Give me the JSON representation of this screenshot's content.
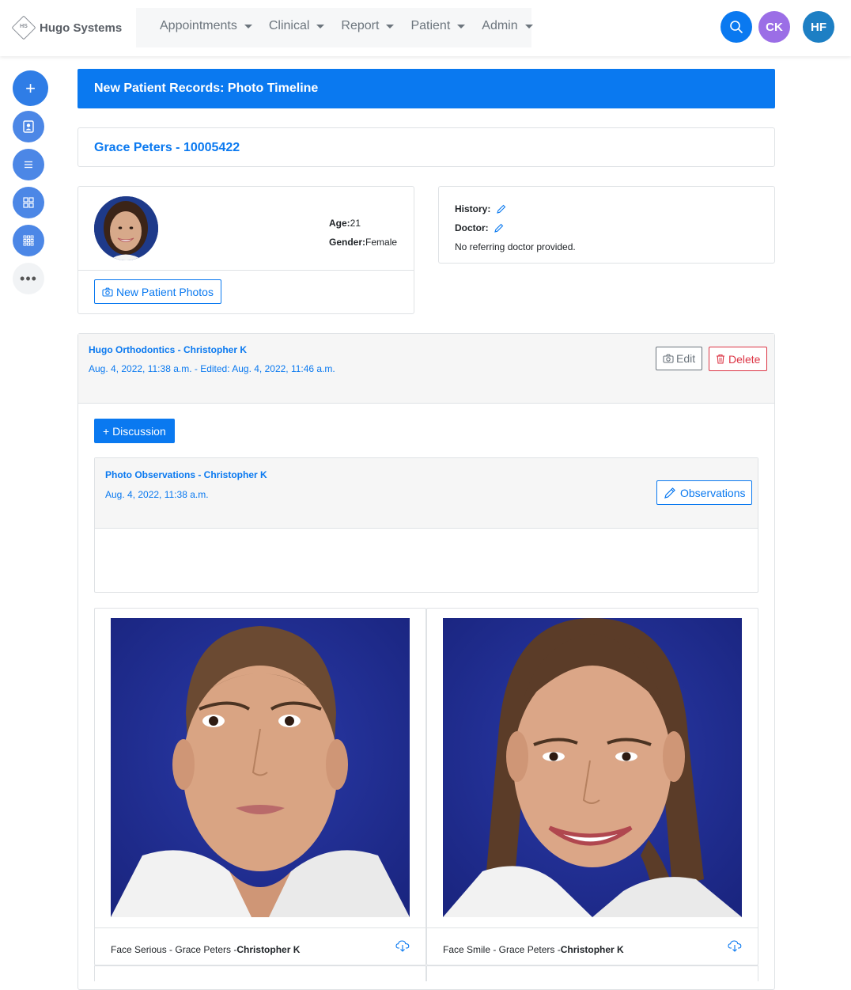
{
  "brand": {
    "logo_text": "HS",
    "name": "Hugo Systems"
  },
  "nav": {
    "items": [
      {
        "label": "Appointments"
      },
      {
        "label": "Clinical"
      },
      {
        "label": "Report"
      },
      {
        "label": "Patient"
      },
      {
        "label": "Admin"
      }
    ],
    "user_initials_1": "CK",
    "user_initials_2": "HF"
  },
  "sidebar": {
    "items": [
      "add-icon",
      "patient-card-icon",
      "list-icon",
      "grid-icon",
      "apps-icon",
      "more-icon"
    ],
    "add_glyph": "+",
    "more_glyph": "•••"
  },
  "page": {
    "title": "New Patient Records: Photo Timeline",
    "patient_header": "Grace Peters - 10005422"
  },
  "profile": {
    "age_label": "Age:",
    "age_value": "21",
    "gender_label": "Gender:",
    "gender_value": "Female",
    "new_photos_button": "New Patient Photos"
  },
  "history": {
    "history_label": "History:",
    "doctor_label": "Doctor:",
    "doctor_note": "No referring doctor provided."
  },
  "timeline": {
    "author": "Hugo Orthodontics - Christopher K",
    "date": "Aug. 4, 2022, 11:38 a.m. - Edited: Aug. 4, 2022, 11:46 a.m.",
    "edit_button": "Edit",
    "delete_button": "Delete",
    "discussion_button": "+ Discussion"
  },
  "observations": {
    "author": "Photo Observations - Christopher K",
    "date": "Aug. 4, 2022, 11:38 a.m.",
    "button": "Observations",
    "body": ""
  },
  "photos": [
    {
      "caption": "Face Serious - Grace Peters -",
      "author": "Christopher K"
    },
    {
      "caption": "Face Smile - Grace Peters -",
      "author": "Christopher K"
    }
  ],
  "colors": {
    "primary": "#0a79f0",
    "danger": "#dc3545",
    "secondary": "#6c757d",
    "avatar_purple": "#9b6ee6",
    "avatar_teal": "#1d7fc4",
    "photo_backdrop": "#1f2f9a"
  }
}
